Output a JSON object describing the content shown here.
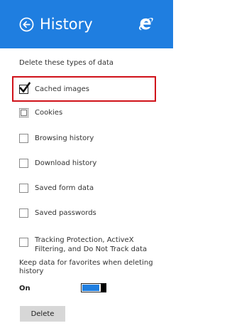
{
  "colors": {
    "header_bg": "#1f7ee0",
    "highlight_border": "#d0121a",
    "toggle_on": "#1f7ee0"
  },
  "header": {
    "title": "History",
    "back_icon": "back-arrow-circle-icon",
    "logo_icon": "internet-explorer-logo-icon"
  },
  "section_label": "Delete these types of data",
  "options": [
    {
      "label": "Cached images",
      "checked": true
    },
    {
      "label": "Cookies",
      "checked": false
    },
    {
      "label": "Browsing history",
      "checked": false
    },
    {
      "label": "Download history",
      "checked": false
    },
    {
      "label": "Saved form data",
      "checked": false
    },
    {
      "label": "Saved passwords",
      "checked": false
    },
    {
      "label": "Tracking Protection, ActiveX Filtering, and Do Not Track data",
      "checked": false
    }
  ],
  "keep_favorites": {
    "label": "Keep data for favorites when deleting history",
    "state": "On"
  },
  "delete_button": "Delete"
}
